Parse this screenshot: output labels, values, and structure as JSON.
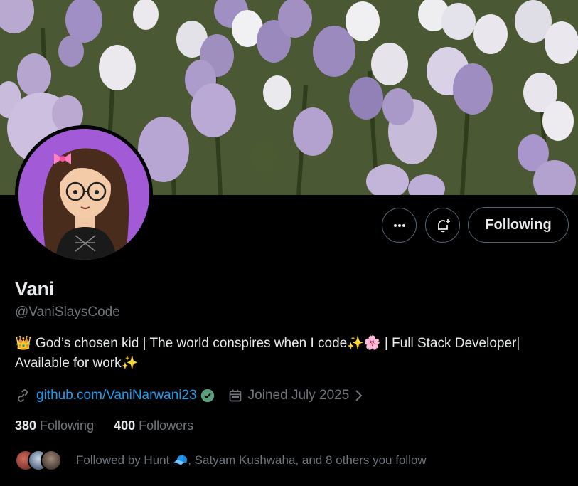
{
  "profile": {
    "name": "Vani",
    "handle": "@VaniSlaysCode",
    "bio": "👑 God’s chosen kid | The world conspires when I code✨🌸 | Full Stack Developer| Available for work✨",
    "website": "github.com/VaniNarwani23",
    "joined": "Joined July 2025",
    "following_count": "380",
    "following_label": "Following",
    "followers_count": "400",
    "followers_label": "Followers",
    "followed_by": "Followed by Hunt 🧢, Satyam Kushwaha, and 8 others you follow"
  },
  "actions": {
    "following_button": "Following"
  },
  "icons": {
    "more": "more-icon",
    "bell": "notification-bell-icon",
    "link": "link-icon",
    "verified": "verified-badge-icon",
    "calendar": "calendar-icon",
    "chevron": "chevron-right-icon"
  },
  "colors": {
    "background": "#000000",
    "link": "#1d9bf0",
    "muted": "#71767b",
    "verified": "#5a9e7e"
  }
}
